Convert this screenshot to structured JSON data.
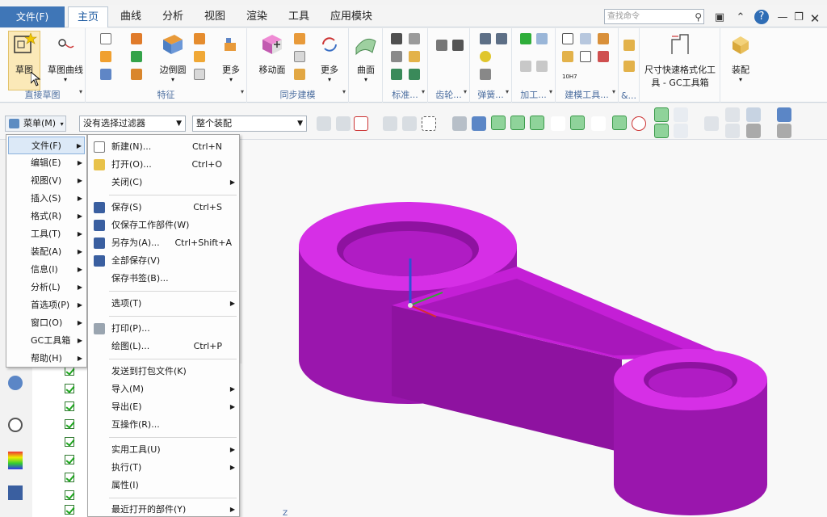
{
  "tabs": {
    "file": "文件(F)",
    "items": [
      "主页",
      "曲线",
      "分析",
      "视图",
      "渲染",
      "工具",
      "应用模块"
    ]
  },
  "search": {
    "placeholder": "查找命令"
  },
  "ribbon": {
    "sketch": "草图",
    "sketch_curve": "草图曲线",
    "group_direct_sketch": "直接草图",
    "edge_blend": "边倒圆",
    "more1": "更多",
    "group_feature": "特征",
    "move_face": "移动面",
    "more2": "更多",
    "group_sync": "同步建模",
    "surface": "曲面",
    "group_standard": "标准...",
    "group_gear": "齿轮...",
    "group_spring": "弹簧...",
    "group_machining": "加工...",
    "group_modeling_tools": "建模工具...",
    "group_more": "&...",
    "dim_format_line1": "尺寸快速格式化工",
    "dim_format_line2": "具 - GC工具箱",
    "assembly": "装配",
    "tol_label": "10H7"
  },
  "selbar": {
    "menu": "菜单(M)",
    "filter": "没有选择过滤器",
    "scope": "整个装配"
  },
  "main_menu": [
    {
      "label": "文件(F)",
      "active": true
    },
    {
      "label": "编辑(E)"
    },
    {
      "label": "视图(V)"
    },
    {
      "label": "插入(S)"
    },
    {
      "label": "格式(R)"
    },
    {
      "label": "工具(T)"
    },
    {
      "label": "装配(A)"
    },
    {
      "label": "信息(I)"
    },
    {
      "label": "分析(L)"
    },
    {
      "label": "首选项(P)"
    },
    {
      "label": "窗口(O)"
    },
    {
      "label": "GC工具箱"
    },
    {
      "label": "帮助(H)"
    }
  ],
  "file_menu": [
    {
      "label": "新建(N)...",
      "shortcut": "Ctrl+N"
    },
    {
      "label": "打开(O)...",
      "shortcut": "Ctrl+O"
    },
    {
      "label": "关闭(C)",
      "shortcut": ""
    },
    {
      "label": "保存(S)",
      "shortcut": "Ctrl+S"
    },
    {
      "label": "仅保存工作部件(W)",
      "shortcut": ""
    },
    {
      "label": "另存为(A)...",
      "shortcut": "Ctrl+Shift+A"
    },
    {
      "label": "全部保存(V)",
      "shortcut": ""
    },
    {
      "label": "保存书签(B)...",
      "shortcut": ""
    },
    {
      "label": "选项(T)",
      "shortcut": ""
    },
    {
      "label": "打印(P)...",
      "shortcut": ""
    },
    {
      "label": "绘图(L)...",
      "shortcut": "Ctrl+P"
    },
    {
      "label": "发送到打包文件(K)",
      "shortcut": ""
    },
    {
      "label": "导入(M)",
      "shortcut": ""
    },
    {
      "label": "导出(E)",
      "shortcut": ""
    },
    {
      "label": "互操作(R)...",
      "shortcut": ""
    },
    {
      "label": "实用工具(U)",
      "shortcut": ""
    },
    {
      "label": "执行(T)",
      "shortcut": ""
    },
    {
      "label": "属性(I)",
      "shortcut": ""
    },
    {
      "label": "最近打开的部件(Y)",
      "shortcut": ""
    }
  ],
  "viewport": {
    "axis_z": "Z"
  },
  "colors": {
    "accent": "#3f76b7",
    "part": "#b01cc4",
    "part_top": "#d62fe6"
  }
}
